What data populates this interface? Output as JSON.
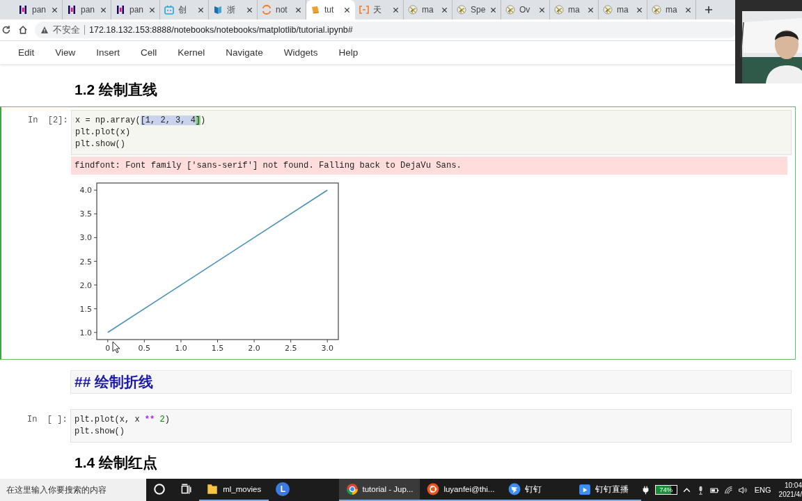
{
  "browser": {
    "tabs": [
      {
        "label": "pan",
        "kind": "pandas",
        "selected": false
      },
      {
        "label": "pan",
        "kind": "pandas",
        "selected": false
      },
      {
        "label": "pan",
        "kind": "pandas",
        "selected": false
      },
      {
        "label": "创",
        "kind": "tv",
        "selected": false
      },
      {
        "label": "浙",
        "kind": "book",
        "selected": false
      },
      {
        "label": "not",
        "kind": "jupyter",
        "selected": false
      },
      {
        "label": "tut",
        "kind": "notebook",
        "selected": true
      },
      {
        "label": "天",
        "kind": "bracket",
        "selected": false
      },
      {
        "label": "ma",
        "kind": "matplotlib",
        "selected": false
      },
      {
        "label": "Spe",
        "kind": "matplotlib",
        "selected": false
      },
      {
        "label": "Ov",
        "kind": "matplotlib",
        "selected": false
      },
      {
        "label": "ma",
        "kind": "matplotlib",
        "selected": false
      },
      {
        "label": "ma",
        "kind": "matplotlib",
        "selected": false
      },
      {
        "label": "ma",
        "kind": "matplotlib",
        "selected": false
      }
    ],
    "address": {
      "warning": "不安全",
      "url": "172.18.132.153:8888/notebooks/notebooks/matplotlib/tutorial.ipynb#"
    }
  },
  "menu": [
    "Edit",
    "View",
    "Insert",
    "Cell",
    "Kernel",
    "Navigate",
    "Widgets",
    "Help"
  ],
  "cells": [
    {
      "kind": "heading",
      "text": "1.2  绘制直线"
    },
    {
      "kind": "code",
      "selected": true,
      "prompt": "In  [2]:",
      "lines": [
        [
          {
            "text": "x = np.array("
          },
          {
            "text": "[1, 2, 3, 4",
            "kind": "selection"
          },
          {
            "text": "]",
            "kind": "match"
          },
          {
            "text": ")"
          }
        ],
        [
          {
            "text": "plt.plot(x)"
          }
        ],
        [
          {
            "text": "plt.show()"
          }
        ]
      ],
      "error": "findfont: Font family ['sans-serif'] not found. Falling back to DejaVu Sans.",
      "chart_data": {
        "type": "line",
        "x": [
          0,
          1,
          2,
          3
        ],
        "series": [
          {
            "color": "#4a90b8",
            "values": [
              1,
              2,
              3,
              4
            ]
          }
        ],
        "xlim": [
          -0.15,
          3.15
        ],
        "ylim": [
          0.85,
          4.15
        ],
        "xticks": [
          {
            "value": 0,
            "label": "0"
          },
          {
            "value": 0.5,
            "label": "0.5"
          },
          {
            "value": 1,
            "label": "1.0"
          },
          {
            "value": 1.5,
            "label": "1.5"
          },
          {
            "value": 2,
            "label": "2.0"
          },
          {
            "value": 2.5,
            "label": "2.5"
          },
          {
            "value": 3,
            "label": "3.0"
          }
        ],
        "yticks": [
          {
            "value": 1,
            "label": "1.0"
          },
          {
            "value": 1.5,
            "label": "1.5"
          },
          {
            "value": 2,
            "label": "2.0"
          },
          {
            "value": 2.5,
            "label": "2.5"
          },
          {
            "value": 3,
            "label": "3.0"
          },
          {
            "value": 3.5,
            "label": "3.5"
          },
          {
            "value": 4,
            "label": "4.0"
          }
        ]
      }
    },
    {
      "kind": "markdown",
      "selected": false,
      "text": "## 绘制折线"
    },
    {
      "kind": "code",
      "selected": false,
      "prompt": "In  [ ]:",
      "lines": [
        [
          {
            "text": "plt.plot(x, x "
          },
          {
            "text": "**",
            "kind": "operator"
          },
          {
            "text": " 2",
            "kind": "number"
          },
          {
            "text": ")"
          }
        ],
        [
          {
            "text": "plt.show()"
          }
        ]
      ]
    },
    {
      "kind": "heading",
      "text": "1.4  绘制红点"
    }
  ],
  "taskbar": {
    "search_placeholder": "在这里输入你要搜索的内容",
    "apps": [
      {
        "kind": "cortana",
        "selected": false,
        "running": false
      },
      {
        "kind": "taskview",
        "selected": false,
        "running": false
      },
      {
        "kind": "folder",
        "label": "ml_movies",
        "selected": false,
        "running": true
      },
      {
        "kind": "letter",
        "label": "L",
        "selected": false,
        "running": false
      },
      {
        "kind": "chrome",
        "label": "tutorial - Jup...",
        "selected": true,
        "running": true
      },
      {
        "kind": "ubuntu",
        "label": "luyanfei@thi...",
        "selected": false,
        "running": true
      },
      {
        "kind": "dingtalk",
        "label": "钉钉",
        "selected": false,
        "running": true
      },
      {
        "kind": "live",
        "label": "钉钉直播",
        "selected": false,
        "running": true
      }
    ],
    "battery": {
      "label": "74%",
      "level": 0.74
    },
    "language": "ENG",
    "time": "10:04",
    "date": "2021/4/"
  }
}
